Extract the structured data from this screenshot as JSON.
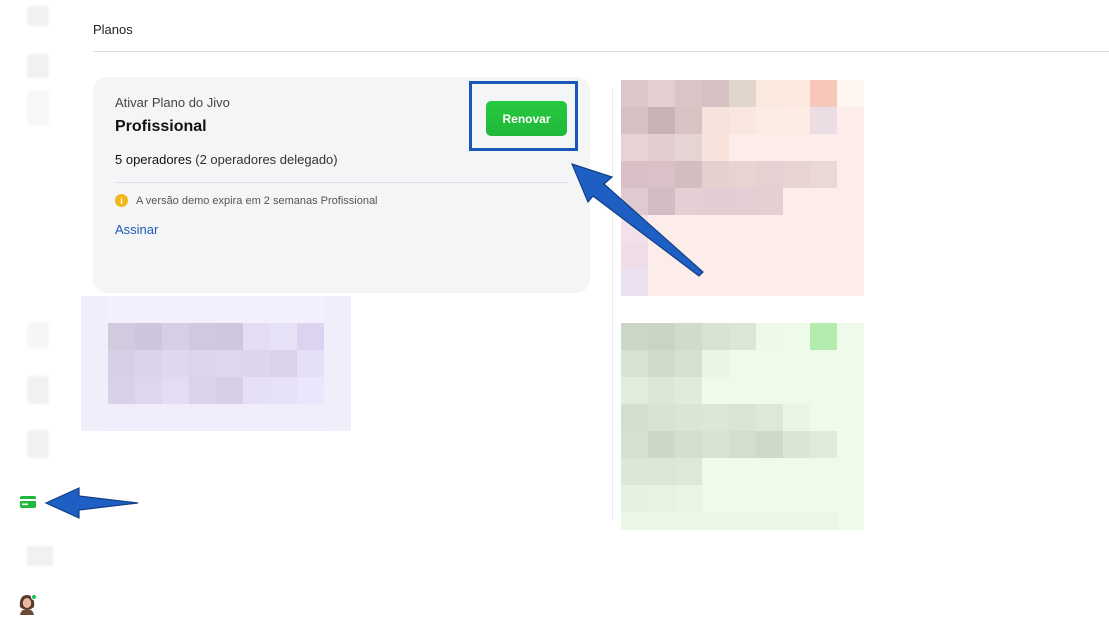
{
  "header": {
    "title": "Planos"
  },
  "plan_card": {
    "label": "Ativar Plano do Jivo",
    "plan_name": "Profissional",
    "operators_main": "5 operadores",
    "operators_detail": " (2 operadores delegado)",
    "demo_notice": "A versão demo expira em 2 semanas Profissional",
    "subscribe_link": "Assinar",
    "renew_button": "Renovar"
  },
  "colors": {
    "accent_green": "#22c55e",
    "link_blue": "#1f5bb3",
    "annotation_blue": "#1957b8",
    "info_yellow": "#f2b81a"
  },
  "icons": {
    "sidebar_active": "credit-card-icon",
    "info": "info-icon",
    "avatar": "user-avatar"
  }
}
